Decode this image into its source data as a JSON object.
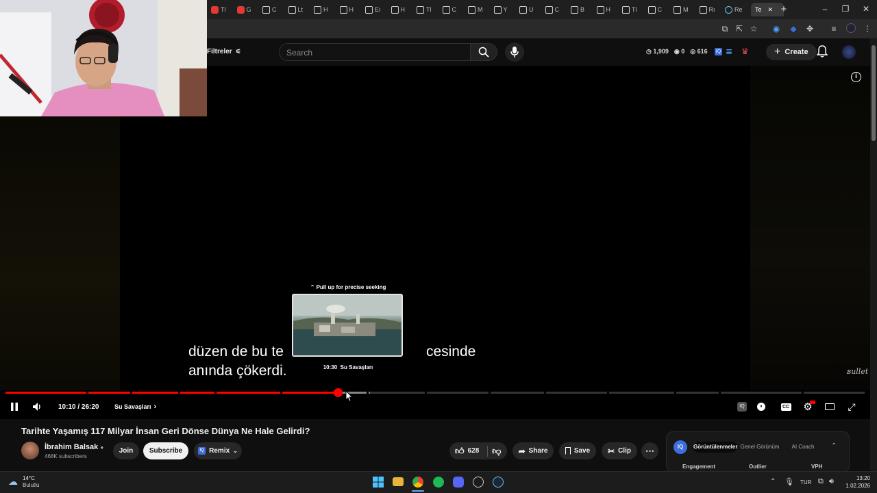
{
  "browser": {
    "tabs": [
      {
        "label": "Tl",
        "fav": "youtube"
      },
      {
        "label": "G",
        "fav": "youtube"
      },
      {
        "label": "C",
        "fav": "db"
      },
      {
        "label": "Lt",
        "fav": "db"
      },
      {
        "label": "H",
        "fav": "db"
      },
      {
        "label": "H",
        "fav": "db"
      },
      {
        "label": "Eı",
        "fav": "db"
      },
      {
        "label": "H",
        "fav": "db"
      },
      {
        "label": "Tl",
        "fav": "db"
      },
      {
        "label": "C",
        "fav": "db"
      },
      {
        "label": "M",
        "fav": "db"
      },
      {
        "label": "Y",
        "fav": "db"
      },
      {
        "label": "U",
        "fav": "db"
      },
      {
        "label": "C",
        "fav": "db"
      },
      {
        "label": "B",
        "fav": "db"
      },
      {
        "label": "H",
        "fav": "db"
      },
      {
        "label": "Tl",
        "fav": "db"
      },
      {
        "label": "C",
        "fav": "db"
      },
      {
        "label": "M",
        "fav": "db"
      },
      {
        "label": "Rı",
        "fav": "db"
      },
      {
        "label": "Re",
        "fav": "steam"
      }
    ],
    "active_tab_label": "Te",
    "new_tab": "+",
    "window_controls": [
      "–",
      "❐",
      "✕"
    ]
  },
  "header": {
    "filters_label": "Filtreler",
    "search_placeholder": "Search",
    "stats": {
      "views": "1,909",
      "likes": "0",
      "comments": "616"
    },
    "create_label": "Create"
  },
  "player": {
    "subtitle_line1": "düzen de bu te",
    "subtitle_line1_end": "cesinde",
    "subtitle_line2": "anında çökerdi.",
    "seek_hint": "Pull up for precise seeking",
    "preview_time": "10:30",
    "preview_chapter": "Su Savaşları",
    "time_display": "10:10 / 26:20",
    "chapter": "Su Savaşları",
    "progress_played_fraction": 0.3865,
    "progress_buffered_fraction": 0.4245,
    "watermark": "bullet"
  },
  "video": {
    "title": "Tarihte Yaşamış 117 Milyar İnsan Geri Dönse Dünya Ne Hale Gelirdi?",
    "channel": "İbrahim Balsak",
    "subscribers": "468K subscribers",
    "join_label": "Join",
    "subscribe_label": "Subscribe",
    "remix_label": "Remix",
    "likes": "628",
    "share_label": "Share",
    "save_label": "Save",
    "clip_label": "Clip"
  },
  "iq_panel": {
    "badge": "IQ",
    "tabs": [
      "Görüntülenmeler",
      "Genel Görünüm",
      "AI Coach"
    ],
    "columns": [
      "Engagement",
      "Outlier",
      "VPH"
    ]
  },
  "taskbar": {
    "weather_temp": "14°C",
    "weather_desc": "Bulutlu",
    "language": "TUR",
    "time": "13:20",
    "date": "1.02.2026"
  },
  "colors": {
    "accent_red": "#ff0000",
    "iq_blue": "#3b6fe0"
  }
}
